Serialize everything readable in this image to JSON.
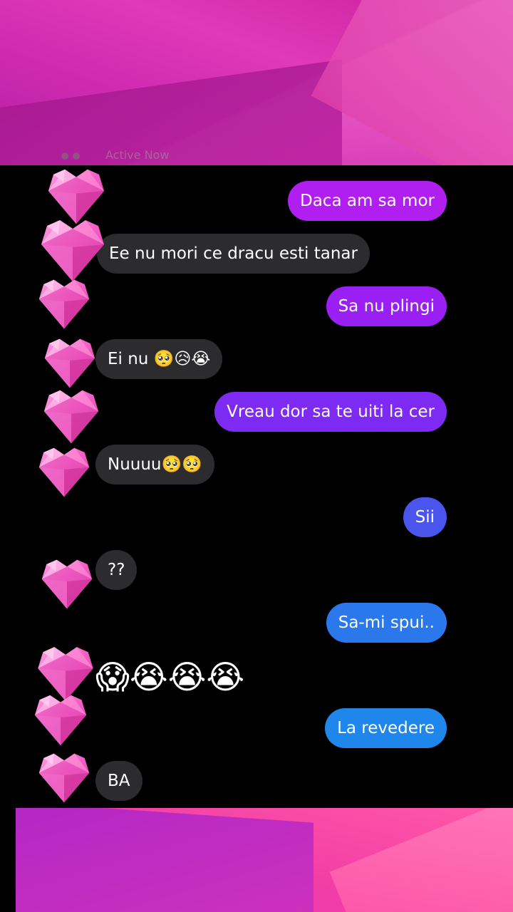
{
  "status": {
    "text": "Active Now"
  },
  "messages": [
    {
      "id": "m1",
      "side": "sent",
      "text": "Daca am sa mor"
    },
    {
      "id": "m2",
      "side": "received",
      "text": "Ee nu mori ce dracu esti  tanar"
    },
    {
      "id": "m3",
      "side": "sent",
      "text": "Sa nu plingi"
    },
    {
      "id": "m4",
      "side": "received",
      "text": "Ei nu 🥺😥😭"
    },
    {
      "id": "m5",
      "side": "sent",
      "text": "Vreau dor sa te uiti la cer"
    },
    {
      "id": "m6",
      "side": "received",
      "text": "Nuuuu🥺🥺"
    },
    {
      "id": "m7",
      "side": "sent",
      "text": "Sii"
    },
    {
      "id": "m8",
      "side": "received",
      "text": "??"
    },
    {
      "id": "m9",
      "side": "sent",
      "text": "Sa-mi spui.."
    },
    {
      "id": "m10",
      "side": "received",
      "text": "😱😭😭😭"
    },
    {
      "id": "m11",
      "side": "sent",
      "text": "La revedere"
    },
    {
      "id": "m12",
      "side": "received",
      "text": "BA"
    }
  ],
  "colors": {
    "received_bubble": "#2c2c2e",
    "sent_purple": "#b11ff0",
    "sent_violet": "#7d2bf2",
    "sent_blue": "#1f86ec",
    "heart_pink": "#f25fc6",
    "background_pink": "#d02bb1"
  },
  "icons": {
    "avatar_sticker": "pink-heart-icon"
  }
}
